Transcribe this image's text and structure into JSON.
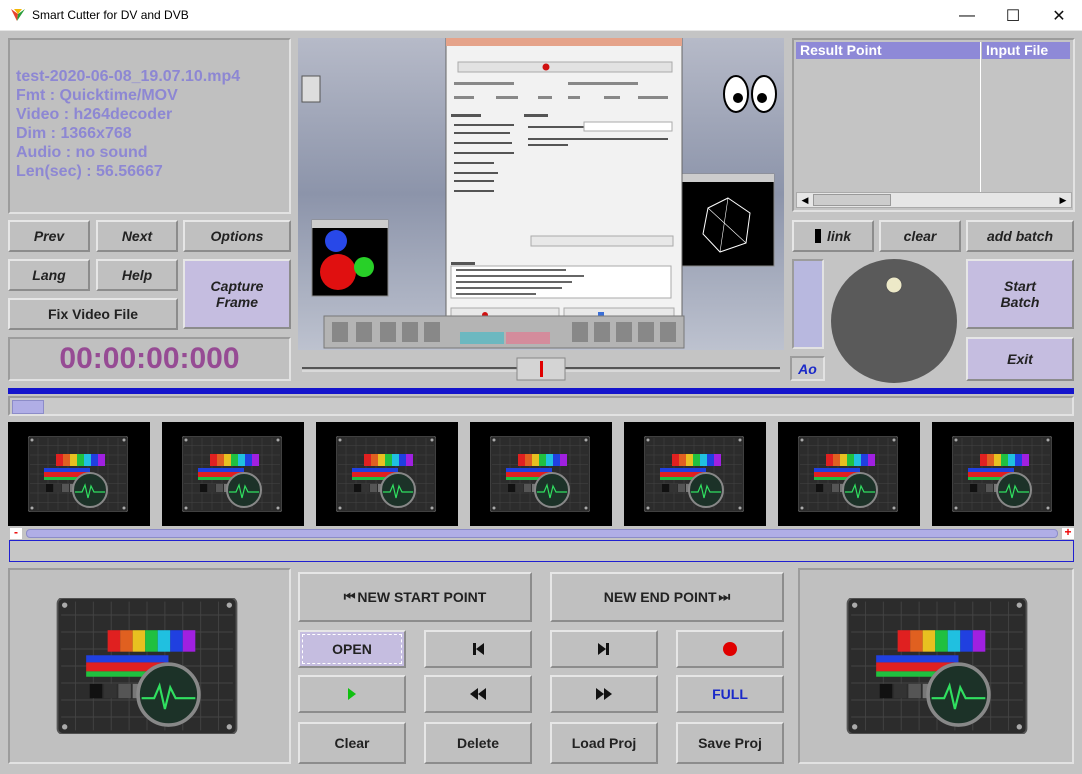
{
  "window": {
    "title": "Smart Cutter for DV and DVB",
    "controls": {
      "minimize": "—",
      "maximize": "☐",
      "close": "✕"
    }
  },
  "info": {
    "filename": "test-2020-06-08_19.07.10.mp4",
    "format": "Fmt : Quicktime/MOV",
    "video": "Video : h264decoder",
    "dim": "Dim : 1366x768",
    "audio": "Audio : no sound",
    "length": "Len(sec) : 56.56667"
  },
  "left_buttons": {
    "prev": "Prev",
    "next": "Next",
    "options": "Options",
    "lang": "Lang",
    "help": "Help",
    "capture": "Capture Frame",
    "fix": "Fix Video File"
  },
  "timecode": "00:00:00:000",
  "result_list": {
    "col1": "Result Point",
    "col2": "Input File"
  },
  "right_buttons": {
    "link": "link",
    "clear": "clear",
    "add_batch": "add batch",
    "start_batch": "Start Batch",
    "exit": "Exit",
    "ao": "Ao"
  },
  "scrub_markers": {
    "minus": "-",
    "plus": "+"
  },
  "bottom_buttons": {
    "new_start": "NEW START POINT",
    "new_end": "NEW END POINT",
    "open": "OPEN",
    "full": "FULL",
    "clear": "Clear",
    "delete": "Delete",
    "load_proj": "Load Proj",
    "save_proj": "Save Proj"
  },
  "thumbnail_count": 7,
  "colors": {
    "accent_lilac": "#c5bde0",
    "info_text": "#8d87d3",
    "timecode": "#964b94",
    "record_red": "#e00000",
    "play_green": "#10c010",
    "blue_line": "#1414cc"
  },
  "icons": {
    "prev_frame": "step-back-icon",
    "next_frame": "step-forward-icon",
    "record": "record-icon",
    "play": "play-icon",
    "rewind": "rewind-icon",
    "fast_forward": "fast-forward-icon"
  }
}
